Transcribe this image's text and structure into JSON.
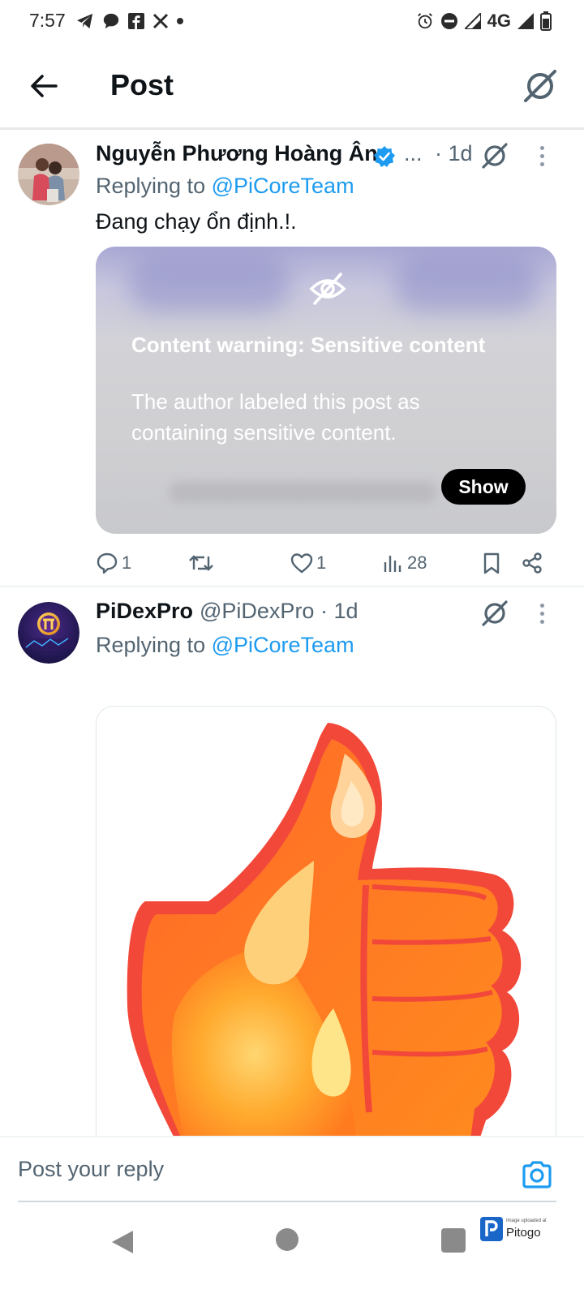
{
  "status_bar": {
    "time": "7:57",
    "network": "4G",
    "left_icons": [
      "telegram-icon",
      "chat-bubble-icon",
      "facebook-icon",
      "x-icon",
      "dot-icon"
    ],
    "right_icons": [
      "alarm-icon",
      "dnd-icon",
      "signal-icon",
      "signal-icon",
      "battery-icon"
    ]
  },
  "header": {
    "title": "Post",
    "back_icon": "arrow-left-icon",
    "action_icon": "grok-icon"
  },
  "posts": [
    {
      "author": "Nguyễn Phương Hoàng Ân",
      "verified": true,
      "name_truncation": "...",
      "time": "· 1d",
      "replying_prefix": "Replying to ",
      "replying_to": "@PiCoreTeam",
      "text": "Đang chạy ổn định.!.",
      "sensitive": {
        "title": "Content warning: Sensitive content",
        "description": "The author labeled this post as containing sensitive content.",
        "button": "Show"
      },
      "stats": {
        "replies": "1",
        "reposts": "",
        "likes": "1",
        "views": "28"
      }
    },
    {
      "author": "PiDexPro",
      "handle": "@PiDexPro · 1d",
      "replying_prefix": "Replying to ",
      "replying_to": "@PiCoreTeam",
      "image_alt": "fire-thumbs-up"
    }
  ],
  "reply_bar": {
    "placeholder": "Post your reply",
    "camera_icon": "camera-icon"
  },
  "nav_bar": {
    "icons": [
      "nav-back-icon",
      "nav-home-icon",
      "nav-recents-icon"
    ]
  },
  "watermark": {
    "caption": "Image uploaded at",
    "brand": "Pitogo"
  },
  "colors": {
    "accent": "#1d9bf0",
    "text_primary": "#0f1419",
    "text_secondary": "#536471",
    "divider": "#eff3f4"
  }
}
